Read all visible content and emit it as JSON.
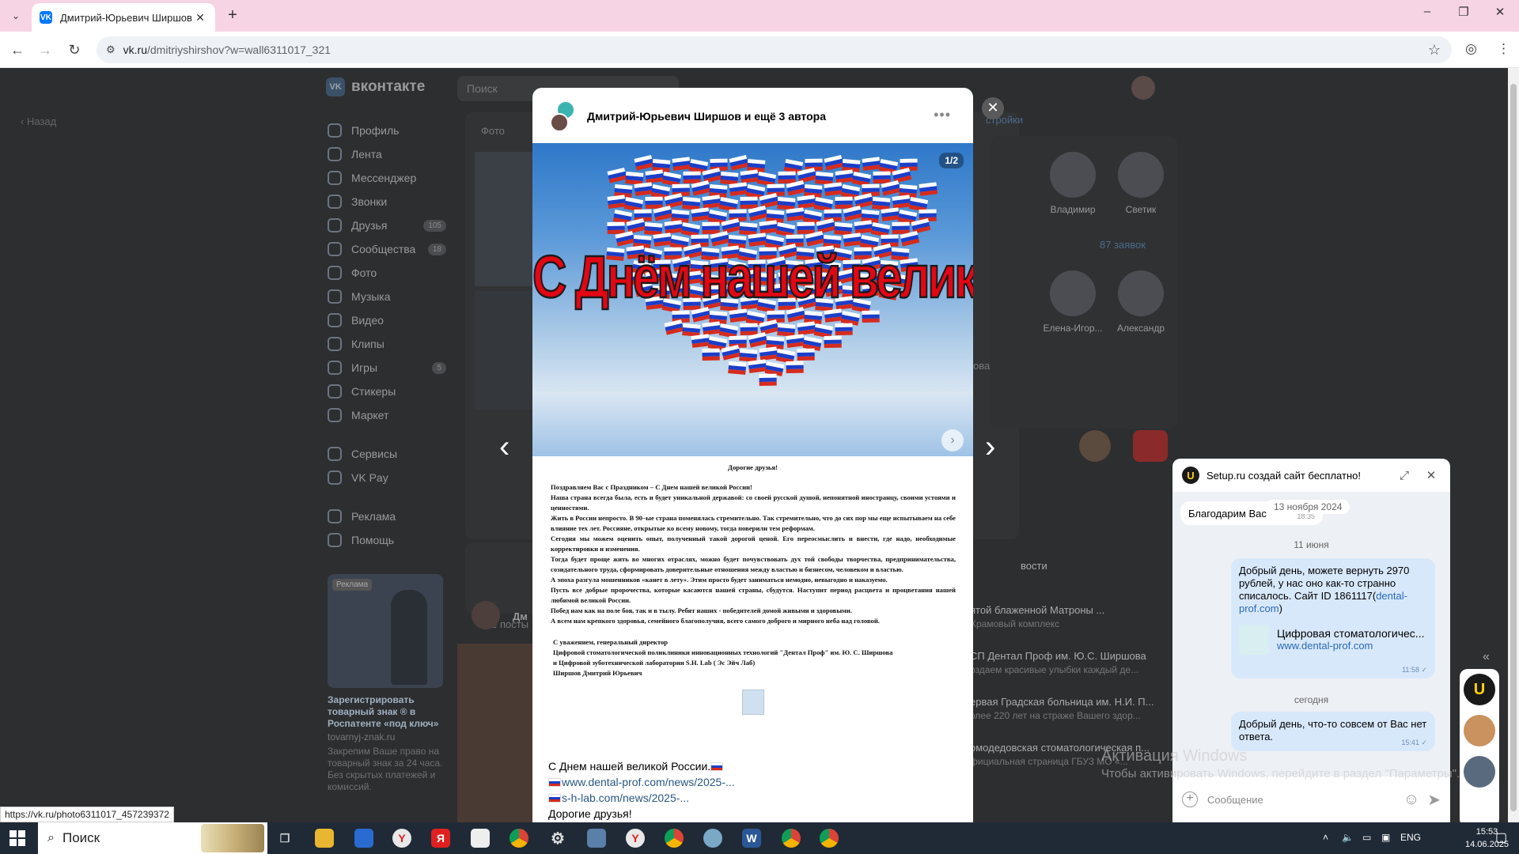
{
  "browser": {
    "tab_title": "Дмитрий-Юрьевич Ширшов",
    "tab_favicon": "VK",
    "url_host": "vk.ru",
    "url_path": "/dmitriyshirshov?w=wall6311017_321",
    "status_url": "https://vk.ru/photo6311017_457239372"
  },
  "vk": {
    "logo": "вконтакте",
    "search_placeholder": "Поиск",
    "back_label": "Назад",
    "nav": [
      {
        "label": "Профиль",
        "count": ""
      },
      {
        "label": "Лента",
        "count": ""
      },
      {
        "label": "Мессенджер",
        "count": ""
      },
      {
        "label": "Звонки",
        "count": ""
      },
      {
        "label": "Друзья",
        "count": "105"
      },
      {
        "label": "Сообщества",
        "count": "18"
      },
      {
        "label": "Фото",
        "count": ""
      },
      {
        "label": "Музыка",
        "count": ""
      },
      {
        "label": "Видео",
        "count": ""
      },
      {
        "label": "Клипы",
        "count": ""
      },
      {
        "label": "Игры",
        "count": "5"
      },
      {
        "label": "Стикеры",
        "count": ""
      },
      {
        "label": "Маркет",
        "count": ""
      }
    ],
    "nav2": [
      {
        "label": "Сервисы"
      },
      {
        "label": "VK Pay"
      }
    ],
    "nav3": [
      {
        "label": "Реклама"
      },
      {
        "label": "Помощь"
      }
    ],
    "ad": {
      "tag": "Реклама",
      "title": "Зарегистрировать товарный знак ® в Роспатенте «под ключ»",
      "source": "tovarnyj-znak.ru",
      "desc": "Закрепим Ваше право на товарный знак за 24 часа. Без скрытых платежей и комиссий."
    },
    "bg": {
      "photo_tab": "Фото",
      "all_posts": "Все посты",
      "post_author_short": "Дм",
      "settings": "стройки",
      "requests": "87 заявок",
      "friends": [
        {
          "name": "Владимир"
        },
        {
          "name": "Светик"
        },
        {
          "name": "Елена-Игор..."
        },
        {
          "name": "Александр"
        }
      ],
      "news_title": "вости",
      "news": [
        {
          "t": "ятой блаженной Матроны ...",
          "s": "Храмовый комплекс"
        },
        {
          "t": "СП Дентал Проф им. Ю.С. Ширшова",
          "s": "оздаем красивые улыбки каждый де..."
        },
        {
          "t": "ервая Градская больница им. Н.И. П...",
          "s": "олее 220 лет на страже Вашего здор..."
        },
        {
          "t": "омодедовская стоматологическая п...",
          "s": "фициальная страница ГБУЗ МО «..."
        }
      ],
      "side_a": "ова"
    }
  },
  "post": {
    "authors": "Дмитрий-Юрьевич Ширшов и ещё 3 автора",
    "counter": "1/2",
    "banner": "С Днём нашей великой России!",
    "letter": {
      "greeting": "Дорогие друзья!",
      "paragraphs": [
        "Поздравляем Вас с Праздником – С Днем нашей великой России!",
        "Наша страна всегда была, есть и будет уникальной державой: со своей русской душой, непонятной иностранцу, своими устоями и ценностями.",
        "Жить в России непросто. В 90–ые страна поменялась стремительно. Так стремительно, что до сих пор мы еще испытываем на себе влияние тех лет. Россияне, открытые ко всему новому, тогда поверили тем реформам.",
        "Сегодня мы можем оценить опыт, полученный такой дорогой ценой. Его переосмыслить и внести, где надо, необходимые корректировки и изменения.",
        "Тогда будет проще жить во многих отраслях, можно будет почувствовать дух той свободы творчества, предпринимательства, созидательного труда, сформировать доверительные отношения между властью и бизнесом, человеком и властью.",
        "А эпоха разгула мошенников «канет в лету». Этим просто будет заниматься немодно, невыгодно и наказуемо.",
        "Пусть все добрые пророчества, которые касаются нашей страны, сбудутся. Наступит период расцвета и процветания нашей любимой великой России.",
        "Побед нам как на поле боя, так и в тылу. Ребят наших - победителей домой живыми и здоровыми.",
        "А всем нам крепкого здоровья, семейного благополучия, всего самого доброго и мирного неба над головой."
      ],
      "signature": [
        "С уважением, генеральный директор",
        "Цифровой стоматологической поликлиники инновационных технологий \"Дентал Проф\" им. Ю. С. Ширшова",
        "и Цифровой зуботехнической лаборатории S.H. Lab ( Эс Эйч Лаб)",
        "Ширшов Дмитрий Юрьевич"
      ]
    },
    "text_line1": "С Днем нашей великой России.",
    "link1": "www.dental-prof.com/news/2025-...",
    "link2": "s-h-lab.com/news/2025-...",
    "text_line2": "Дорогие друзья!"
  },
  "chat": {
    "title": "Setup.ru создай сайт бесплатно!",
    "msg_in": "Благодарим Вас",
    "msg_in_time": "18:35",
    "date_old": "13 ноября 2024",
    "day1": "11 июня",
    "msg_out1": "Добрый день, можете вернуть 2970 рублей, у нас оно как-то странно списалось. Сайт ID 1861117(",
    "msg_out1_link": "dental-prof.com",
    "msg_out1_end": ")",
    "card_title": "Цифровая стоматологичес...",
    "card_link": "www.dental-prof.com",
    "msg_out1_time": "11:58 ✓",
    "day2": "сегодня",
    "msg_out2": "Добрый день, что-то совсем от Вас нет ответа.",
    "msg_out2_time": "15:41 ✓",
    "input_placeholder": "Сообщение"
  },
  "windows": {
    "watermark_title": "Активация Windows",
    "watermark_sub": "Чтобы активировать Windows, перейдите в раздел \"Параметры\".",
    "search_label": "Поиск",
    "lang": "ENG",
    "time": "15:53",
    "date": "14.06.2025"
  }
}
